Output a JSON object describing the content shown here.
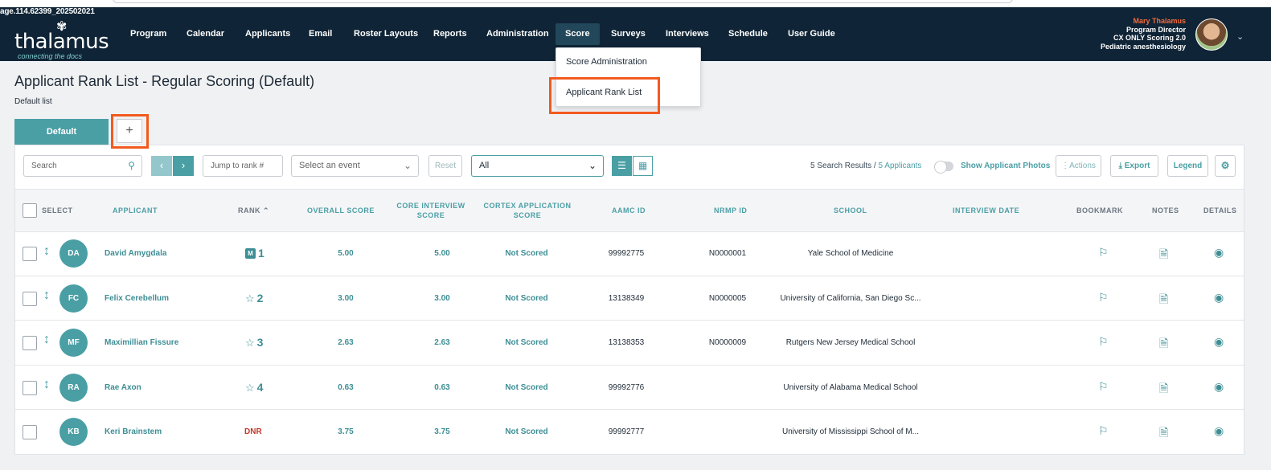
{
  "build_tag": "age.114.62399_202502021",
  "logo": {
    "word": "thalamus",
    "tagline": "connecting the docs"
  },
  "nav": {
    "items": [
      "Program",
      "Calendar",
      "Applicants",
      "Email",
      "Roster Layouts",
      "Reports",
      "Administration",
      "Score",
      "Surveys",
      "Interviews",
      "Schedule",
      "User Guide"
    ],
    "active": "Score"
  },
  "user": {
    "name": "Mary Thalamus",
    "role": "Program Director",
    "scoring": "CX ONLY Scoring 2.0",
    "program": "Pediatric anesthesiology"
  },
  "dropdown": {
    "items": [
      "Score Administration",
      "Applicant Rank List"
    ]
  },
  "page": {
    "title": "Applicant Rank List - Regular Scoring (Default)",
    "subtitle": "Default list"
  },
  "tabs": {
    "default_label": "Default",
    "add_label": "+"
  },
  "toolbar": {
    "search_placeholder": "Search",
    "jump_placeholder": "Jump to rank #",
    "event_placeholder": "Select an event",
    "reset_label": "Reset",
    "filter_value": "All",
    "results_text": "5 Search Results /",
    "applicants_text": "5 Applicants",
    "photos_label": "Show Applicant Photos",
    "actions_label": "Actions",
    "export_label": "Export",
    "legend_label": "Legend"
  },
  "columns": {
    "select": "SELECT",
    "applicant": "APPLICANT",
    "rank": "RANK",
    "overall": "OVERALL SCORE",
    "core_line1": "CORE INTERVIEW",
    "core_line2": "SCORE",
    "cortex_line1": "CORTEX APPLICATION",
    "cortex_line2": "SCORE",
    "aamc": "AAMC ID",
    "nrmp": "NRMP ID",
    "school": "SCHOOL",
    "interview_date": "INTERVIEW DATE",
    "bookmark": "BOOKMARK",
    "notes": "NOTES",
    "details": "DETAILS"
  },
  "rows": [
    {
      "initials": "DA",
      "name": "David Amygdala",
      "badge": "M",
      "rank": "1",
      "overall": "5.00",
      "core": "5.00",
      "cortex": "Not Scored",
      "aamc": "99992775",
      "nrmp": "N0000001",
      "school": "Yale School of Medicine"
    },
    {
      "initials": "FC",
      "name": "Felix Cerebellum",
      "badge": "☆",
      "rank": "2",
      "overall": "3.00",
      "core": "3.00",
      "cortex": "Not Scored",
      "aamc": "13138349",
      "nrmp": "N0000005",
      "school": "University of California, San Diego Sc..."
    },
    {
      "initials": "MF",
      "name": "Maximillian Fissure",
      "badge": "☆",
      "rank": "3",
      "overall": "2.63",
      "core": "2.63",
      "cortex": "Not Scored",
      "aamc": "13138353",
      "nrmp": "N0000009",
      "school": "Rutgers New Jersey Medical School"
    },
    {
      "initials": "RA",
      "name": "Rae Axon",
      "badge": "☆",
      "rank": "4",
      "overall": "0.63",
      "core": "0.63",
      "cortex": "Not Scored",
      "aamc": "99992776",
      "nrmp": "",
      "school": "University of Alabama Medical School"
    },
    {
      "initials": "KB",
      "name": "Keri Brainstem",
      "badge": "",
      "rank": "DNR",
      "overall": "3.75",
      "core": "3.75",
      "cortex": "Not Scored",
      "aamc": "99992777",
      "nrmp": "",
      "school": "University of Mississippi School of M..."
    }
  ]
}
